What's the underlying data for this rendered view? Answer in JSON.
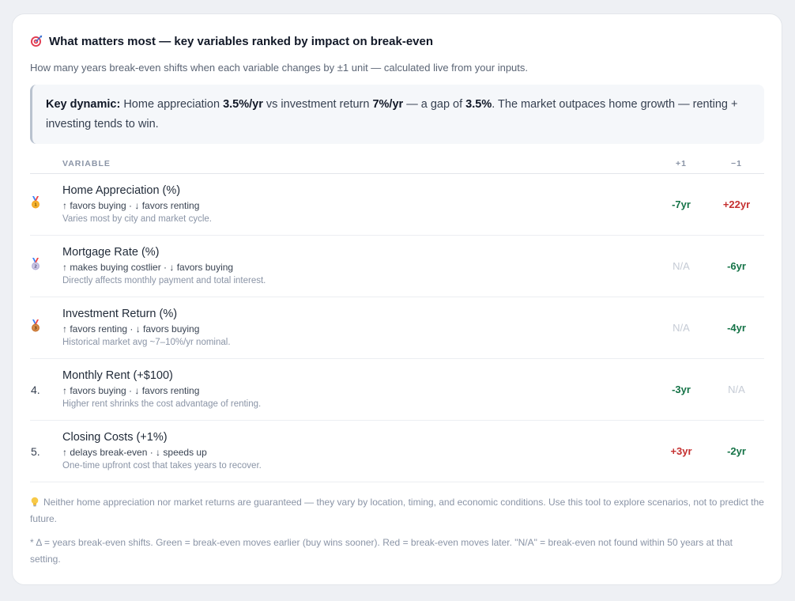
{
  "header": {
    "title": "What matters most — key variables ranked by impact on break-even",
    "icon": "target-icon",
    "subtitle": "How many years break-even shifts when each variable changes by ±1 unit — calculated live from your inputs."
  },
  "callout": {
    "lead": "Key dynamic:",
    "t1": " Home appreciation ",
    "appreciation": "3.5%/yr",
    "t2": " vs investment return ",
    "investment": "7%/yr",
    "t3": " — a gap of ",
    "gap": "3.5%",
    "t4": ". The market outpaces home growth — renting + investing tends to win."
  },
  "table": {
    "headers": {
      "variable": "VARIABLE",
      "plus": "+1",
      "minus": "−1"
    },
    "rows": [
      {
        "rank": "1",
        "medal": "gold-medal-icon",
        "name": "Home Appreciation (%)",
        "direction": "↑ favors buying · ↓ favors renting",
        "note": "Varies most by city and market cycle.",
        "plus": "-7yr",
        "plus_color": "green",
        "minus": "+22yr",
        "minus_color": "red"
      },
      {
        "rank": "2",
        "medal": "silver-medal-icon",
        "name": "Mortgage Rate (%)",
        "direction": "↑ makes buying costlier · ↓ favors buying",
        "note": "Directly affects monthly payment and total interest.",
        "plus": "N/A",
        "plus_color": "na",
        "minus": "-6yr",
        "minus_color": "green"
      },
      {
        "rank": "3",
        "medal": "bronze-medal-icon",
        "name": "Investment Return (%)",
        "direction": "↑ favors renting · ↓ favors buying",
        "note": "Historical market avg ~7–10%/yr nominal.",
        "plus": "N/A",
        "plus_color": "na",
        "minus": "-4yr",
        "minus_color": "green"
      },
      {
        "rank": "4.",
        "medal": "",
        "name": "Monthly Rent (+$100)",
        "direction": "↑ favors buying · ↓ favors renting",
        "note": "Higher rent shrinks the cost advantage of renting.",
        "plus": "-3yr",
        "plus_color": "green",
        "minus": "N/A",
        "minus_color": "na"
      },
      {
        "rank": "5.",
        "medal": "",
        "name": "Closing Costs (+1%)",
        "direction": "↑ delays break-even · ↓ speeds up",
        "note": "One-time upfront cost that takes years to recover.",
        "plus": "+3yr",
        "plus_color": "red",
        "minus": "-2yr",
        "minus_color": "green"
      }
    ]
  },
  "footnotes": {
    "disclaimer": "Neither home appreciation nor market returns are guaranteed — they vary by location, timing, and economic conditions. Use this tool to explore scenarios, not to predict the future.",
    "legend": "* Δ = years break-even shifts. Green = break-even moves earlier (buy wins sooner). Red = break-even moves later. \"N/A\" = break-even not found within 50 years at that setting."
  },
  "colors": {
    "green": "#157347",
    "red": "#c53030",
    "na": "#c5cbd5",
    "gold": "#f5a623",
    "silver": "#b8b3d9",
    "bronze": "#c87533"
  }
}
